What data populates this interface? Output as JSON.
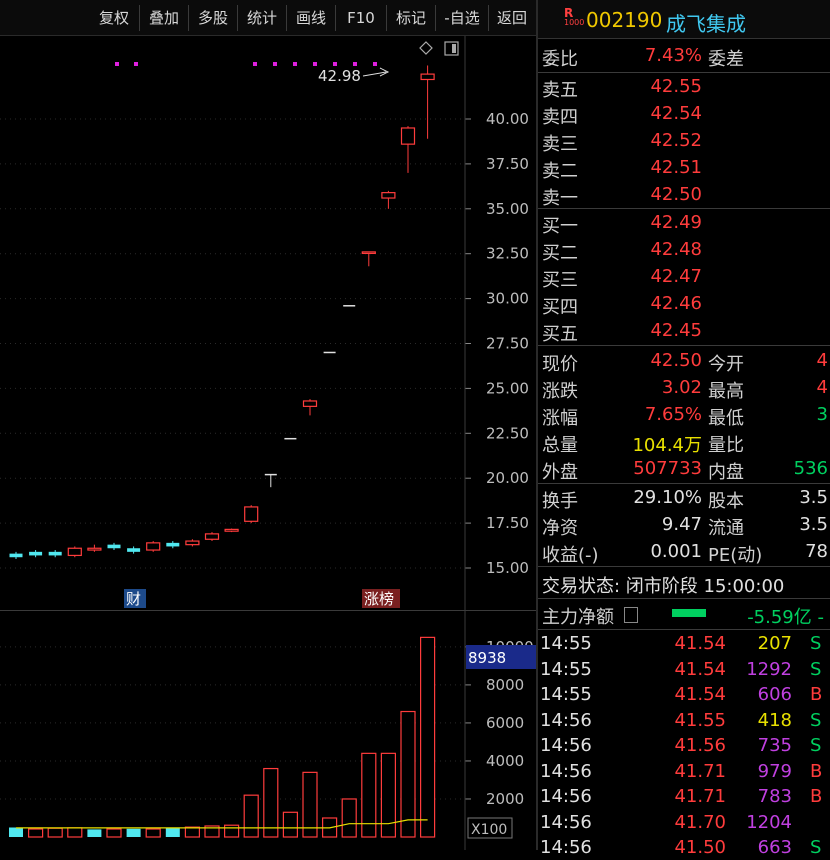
{
  "toolbar": {
    "buttons": [
      "复权",
      "叠加",
      "多股",
      "统计",
      "画线",
      "F10",
      "标记",
      "-自选",
      "返回"
    ]
  },
  "kline": {
    "high_label": "42.98",
    "y_ticks": [
      "40.00",
      "37.50",
      "35.00",
      "32.50",
      "30.00",
      "27.50",
      "25.00",
      "22.50",
      "20.00",
      "17.50",
      "15.00"
    ],
    "tags": {
      "cai": "财",
      "zhangbang": "涨榜"
    },
    "candles": [
      {
        "o": 15.6,
        "c": 15.8,
        "h": 15.9,
        "l": 15.5,
        "t": "c"
      },
      {
        "o": 15.7,
        "c": 15.9,
        "h": 16.0,
        "l": 15.6,
        "t": "c"
      },
      {
        "o": 15.9,
        "c": 15.7,
        "h": 16.0,
        "l": 15.6,
        "t": "g"
      },
      {
        "o": 15.7,
        "c": 16.1,
        "h": 16.2,
        "l": 15.6,
        "t": "r"
      },
      {
        "o": 16.0,
        "c": 16.1,
        "h": 16.3,
        "l": 15.9,
        "t": "r"
      },
      {
        "o": 16.3,
        "c": 16.1,
        "h": 16.4,
        "l": 16.0,
        "t": "c"
      },
      {
        "o": 16.1,
        "c": 15.9,
        "h": 16.2,
        "l": 15.8,
        "t": "c"
      },
      {
        "o": 16.0,
        "c": 16.4,
        "h": 16.5,
        "l": 15.9,
        "t": "r"
      },
      {
        "o": 16.4,
        "c": 16.2,
        "h": 16.5,
        "l": 16.1,
        "t": "c"
      },
      {
        "o": 16.3,
        "c": 16.5,
        "h": 16.6,
        "l": 16.2,
        "t": "r"
      },
      {
        "o": 16.6,
        "c": 16.9,
        "h": 17.0,
        "l": 16.5,
        "t": "r"
      },
      {
        "o": 17.05,
        "c": 17.15,
        "h": 17.2,
        "l": 17.0,
        "t": "r"
      },
      {
        "o": 17.6,
        "c": 18.4,
        "h": 18.5,
        "l": 17.5,
        "t": "r"
      },
      {
        "o": 20.2,
        "c": 20.2,
        "h": 20.2,
        "l": 19.5,
        "t": "w"
      },
      {
        "o": 22.2,
        "c": 22.2,
        "h": 22.2,
        "l": 22.2,
        "t": "w"
      },
      {
        "o": 24.0,
        "c": 24.3,
        "h": 24.4,
        "l": 23.5,
        "t": "r"
      },
      {
        "o": 27.0,
        "c": 27.0,
        "h": 27.0,
        "l": 27.0,
        "t": "w"
      },
      {
        "o": 29.6,
        "c": 29.6,
        "h": 29.6,
        "l": 29.6,
        "t": "w"
      },
      {
        "o": 32.6,
        "c": 32.6,
        "h": 32.6,
        "l": 31.8,
        "t": "r"
      },
      {
        "o": 35.6,
        "c": 35.9,
        "h": 36.0,
        "l": 35.0,
        "t": "r"
      },
      {
        "o": 38.6,
        "c": 39.5,
        "h": 39.6,
        "l": 37.0,
        "t": "r"
      },
      {
        "o": 42.2,
        "c": 42.5,
        "h": 42.98,
        "l": 38.9,
        "t": "r"
      }
    ],
    "y_range": [
      14.0,
      44.0
    ]
  },
  "volume": {
    "y_ticks": [
      "10000",
      "8000",
      "6000",
      "4000",
      "2000"
    ],
    "highlight_value": "8938",
    "unit": "X100",
    "bars": [
      500,
      420,
      460,
      480,
      400,
      420,
      430,
      420,
      480,
      520,
      580,
      620,
      2200,
      3600,
      1300,
      3400,
      1000,
      2000,
      4400,
      4400,
      6600,
      10500
    ],
    "bar_colors": [
      "c",
      "r",
      "r",
      "r",
      "c",
      "r",
      "c",
      "r",
      "c",
      "r",
      "r",
      "r",
      "r",
      "r",
      "r",
      "r",
      "r",
      "r",
      "r",
      "r",
      "r",
      "r"
    ],
    "y_range": [
      0,
      11000
    ]
  },
  "panel": {
    "code": "002190",
    "name": "成飞集成",
    "badge_top": "R",
    "badge_bottom": "1000",
    "weibi": {
      "label": "委比",
      "value": "7.43%",
      "label2": "委差"
    },
    "asks": [
      {
        "label": "卖五",
        "price": "42.55"
      },
      {
        "label": "卖四",
        "price": "42.54"
      },
      {
        "label": "卖三",
        "price": "42.52"
      },
      {
        "label": "卖二",
        "price": "42.51"
      },
      {
        "label": "卖一",
        "price": "42.50"
      }
    ],
    "bids": [
      {
        "label": "买一",
        "price": "42.49"
      },
      {
        "label": "买二",
        "price": "42.48"
      },
      {
        "label": "买三",
        "price": "42.47"
      },
      {
        "label": "买四",
        "price": "42.46"
      },
      {
        "label": "买五",
        "price": "42.45"
      }
    ],
    "quote": [
      {
        "l1": "现价",
        "v1": "42.50",
        "c1": "red",
        "l2": "今开",
        "v2": "4",
        "c2": "red"
      },
      {
        "l1": "涨跌",
        "v1": "3.02",
        "c1": "red",
        "l2": "最高",
        "v2": "4",
        "c2": "red"
      },
      {
        "l1": "涨幅",
        "v1": "7.65%",
        "c1": "red",
        "l2": "最低",
        "v2": "3",
        "c2": "green"
      },
      {
        "l1": "总量",
        "v1": "104.4万",
        "c1": "yellow",
        "l2": "量比",
        "v2": "",
        "c2": "white"
      },
      {
        "l1": "外盘",
        "v1": "507733",
        "c1": "red",
        "l2": "内盘",
        "v2": "536",
        "c2": "green"
      }
    ],
    "fund": [
      {
        "l1": "换手",
        "v1": "29.10%",
        "l2": "股本",
        "v2": "3.5"
      },
      {
        "l1": "净资",
        "v1": "9.47",
        "l2": "流通",
        "v2": "3.5"
      },
      {
        "l1": "收益(-)",
        "v1": "0.001",
        "l2": "PE(动)",
        "v2": "78"
      }
    ],
    "status": "交易状态: 闭市阶段 15:00:00",
    "main_force": {
      "label": "主力净额",
      "value": "-5.59亿",
      "suffix": "-"
    },
    "ticks": [
      {
        "time": "14:55",
        "price": "41.54",
        "vol": "207",
        "vc": "yellow",
        "side": "S"
      },
      {
        "time": "14:55",
        "price": "41.54",
        "vol": "1292",
        "vc": "purple",
        "side": "S"
      },
      {
        "time": "14:55",
        "price": "41.54",
        "vol": "606",
        "vc": "purple",
        "side": "B"
      },
      {
        "time": "14:56",
        "price": "41.55",
        "vol": "418",
        "vc": "yellow",
        "side": "S"
      },
      {
        "time": "14:56",
        "price": "41.56",
        "vol": "735",
        "vc": "purple",
        "side": "S"
      },
      {
        "time": "14:56",
        "price": "41.71",
        "vol": "979",
        "vc": "purple",
        "side": "B"
      },
      {
        "time": "14:56",
        "price": "41.71",
        "vol": "783",
        "vc": "purple",
        "side": "B"
      },
      {
        "time": "14:56",
        "price": "41.70",
        "vol": "1204",
        "vc": "purple",
        "side": ""
      },
      {
        "time": "14:56",
        "price": "41.50",
        "vol": "663",
        "vc": "purple",
        "side": "S"
      }
    ]
  },
  "colors": {
    "up": "#ff3c3c",
    "down_fill": "#50e8f0",
    "flat": "#e0e0e0",
    "ma": "#e8e000",
    "magenta": "#e020e0"
  }
}
